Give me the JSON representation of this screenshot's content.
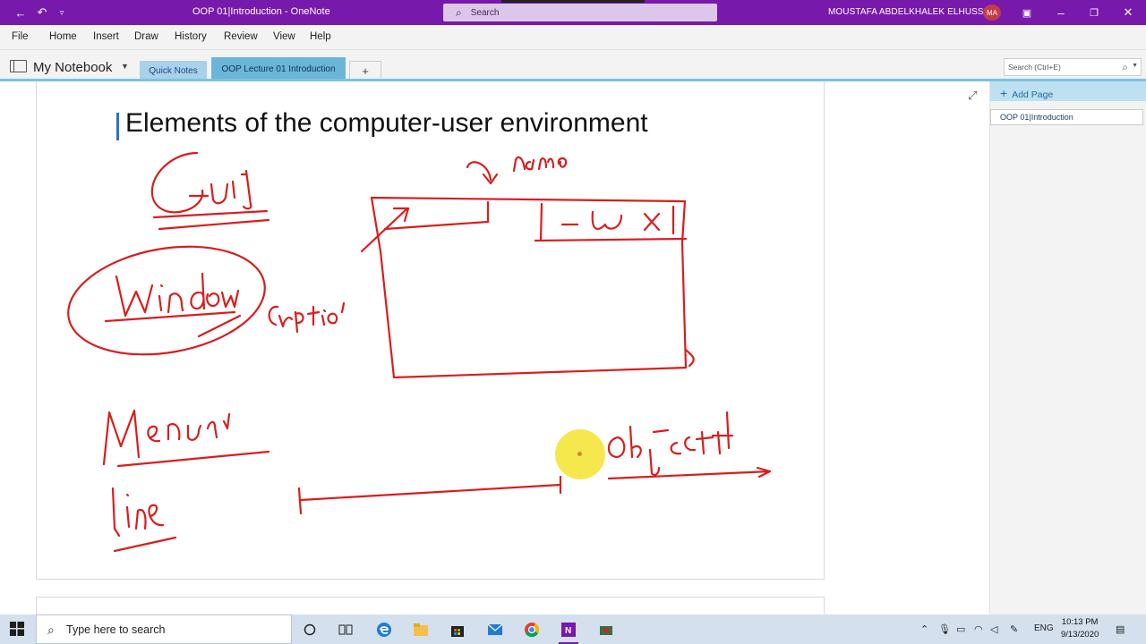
{
  "titlebar": {
    "doc_title": "OOP 01|Introduction  -  OneNote",
    "search_placeholder": "Search",
    "user_name": "MOUSTAFA ABDELKHALEK ELHUSSEI",
    "avatar_initials": "MA",
    "accent_color": "#7719aa"
  },
  "menu": {
    "items": [
      "File",
      "Home",
      "Insert",
      "Draw",
      "History",
      "Review",
      "View",
      "Help"
    ]
  },
  "notebook": {
    "name": "My Notebook",
    "tabs": [
      "Quick Notes",
      "OOP Lecture 01 Introduction"
    ],
    "add_tab": "+",
    "search_placeholder": "Search (Ctrl+E)"
  },
  "page": {
    "title": "Elements of the computer-user environment"
  },
  "pages_pane": {
    "add_page": "Add Page",
    "pages": [
      "OOP 01|Introduction"
    ]
  },
  "taskbar": {
    "search_placeholder": "Type here to search",
    "language": "ENG",
    "time": "10:13 PM",
    "date": "9/13/2020"
  },
  "icons": [
    "back-icon",
    "undo-icon",
    "search-icon",
    "expand-icon",
    "windows-icon",
    "edge-icon",
    "file-explorer-icon",
    "store-icon",
    "mail-icon",
    "chrome-icon",
    "onenote-icon"
  ]
}
